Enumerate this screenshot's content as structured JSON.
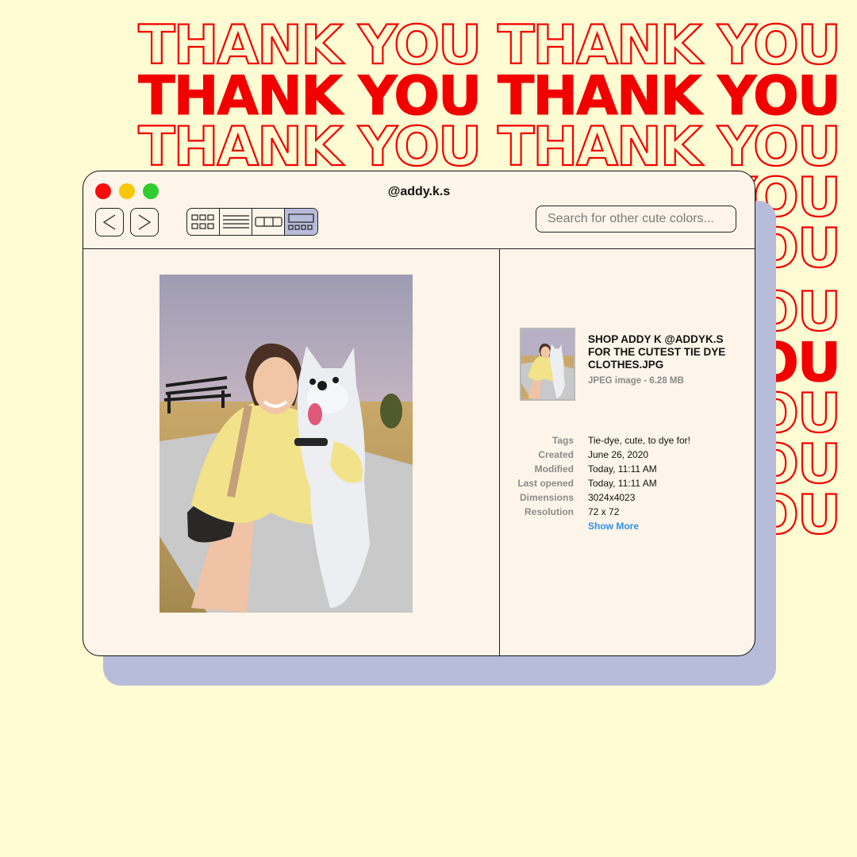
{
  "banner": {
    "text": "THANK YOU THANK YOU",
    "short_text": "YOU",
    "color": "#f20000"
  },
  "window": {
    "title": "@addy.k.s",
    "back_glyph": "<",
    "forward_glyph": ">",
    "view_modes": [
      "icon-view",
      "list-view",
      "column-view",
      "gallery-view"
    ],
    "active_view": "gallery-view",
    "search": {
      "placeholder": "Search for other cute colors...",
      "value": ""
    },
    "accent": "#b8bcdb",
    "traffic_lights": [
      "#f80d0d",
      "#f8c707",
      "#31cc31"
    ]
  },
  "file": {
    "name": "SHOP ADDY K @ADDYK.S\nFOR THE CUTEST TIE DYE\nCLOTHES.JPG",
    "kind_size": "JPEG image - 6.28 MB"
  },
  "metadata": [
    {
      "label": "Tags",
      "value": "Tie-dye, cute, to dye for!"
    },
    {
      "label": "Created",
      "value": "June 26, 2020"
    },
    {
      "label": "Modified",
      "value": "Today, 11:11 AM"
    },
    {
      "label": "Last opened",
      "value": "Today, 11:11 AM"
    },
    {
      "label": "Dimensions",
      "value": "3024x4023"
    },
    {
      "label": "Resolution",
      "value": "72 x 72"
    }
  ],
  "show_more": "Show More"
}
